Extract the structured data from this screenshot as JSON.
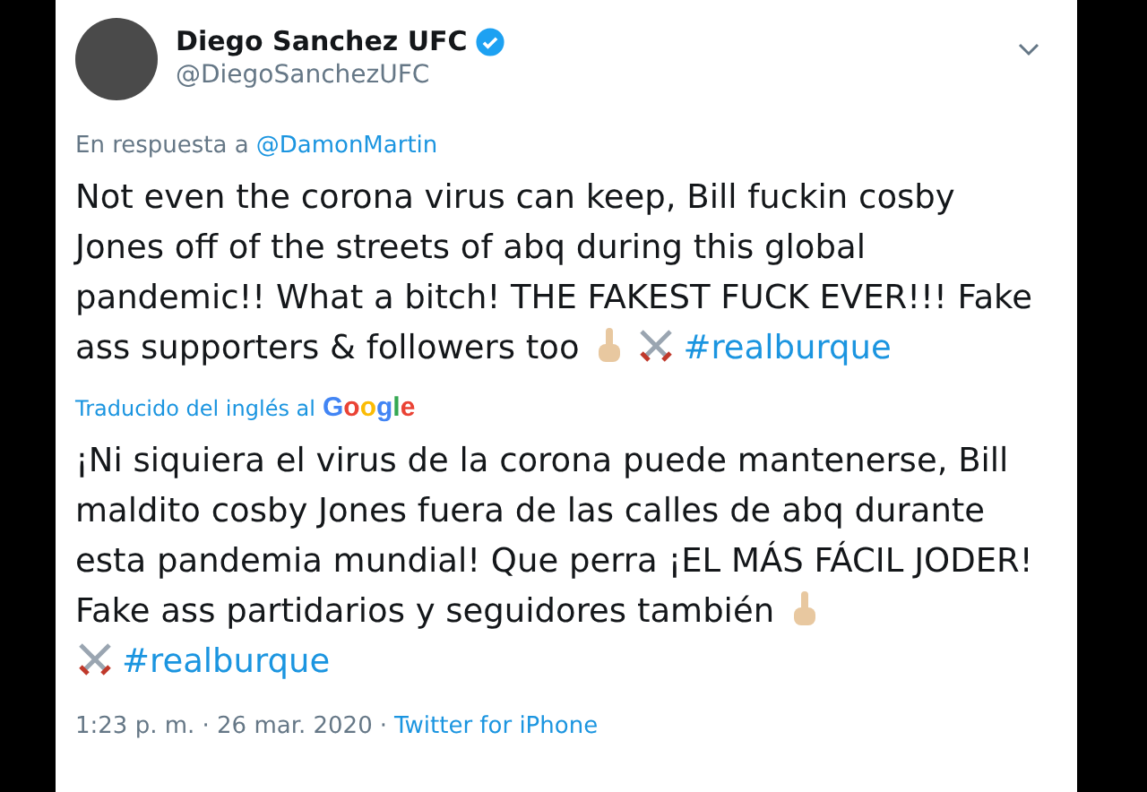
{
  "author": {
    "name": "Diego Sanchez UFC",
    "verified": true,
    "handle": "@DiegoSanchezUFC"
  },
  "reply_to": {
    "prefix": "En respuesta a",
    "mention": "@DamonMartin"
  },
  "tweet": {
    "text": "Not even the corona virus can keep, Bill fuckin cosby Jones off of the streets of abq during this global pandemic!! What a bitch! THE FAKEST FUCK EVER!!! Fake ass supporters & followers too",
    "hashtag": "#realburque"
  },
  "translation": {
    "label": "Traducido del inglés al",
    "provider": "Google",
    "text": "¡Ni siquiera el virus de la corona puede mantenerse, Bill maldito cosby Jones fuera de las calles de abq durante esta pandemia mundial! Que perra ¡EL MÁS FÁCIL JODER! Fake ass partidarios y seguidores también",
    "hashtag": "#realburque"
  },
  "footer": {
    "time": "1:23 p. m. · 26 mar. 2020",
    "separator": "·",
    "source": "Twitter for iPhone"
  }
}
